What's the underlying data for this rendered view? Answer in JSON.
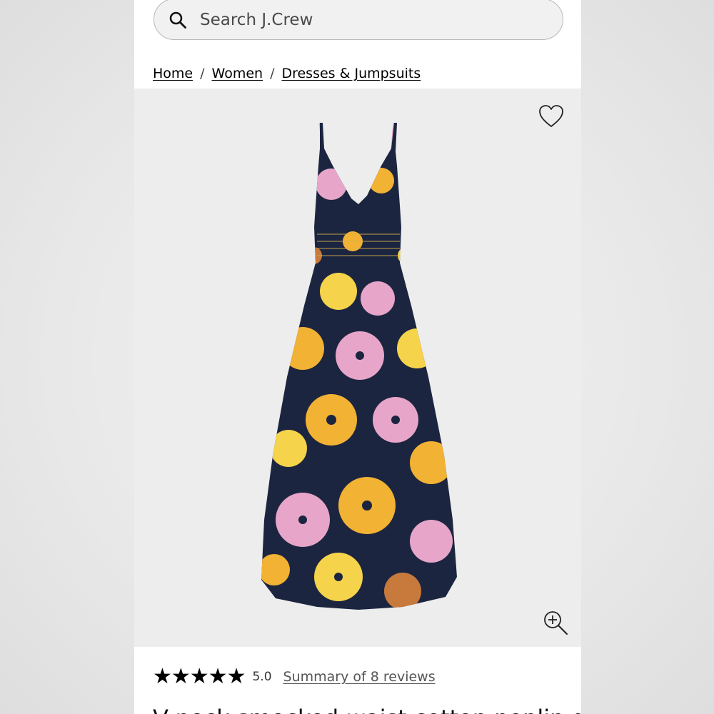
{
  "search": {
    "placeholder": "Search J.Crew",
    "icon": "search-icon"
  },
  "breadcrumb": {
    "items": [
      {
        "label": "Home"
      },
      {
        "label": "Women"
      },
      {
        "label": "Dresses & Jumpsuits"
      }
    ],
    "separator": "/"
  },
  "product_image": {
    "description": "Floral print smocked-waist maxi dress",
    "wishlist_icon": "heart-icon",
    "zoom_icon": "zoom-in-icon",
    "colors": [
      "#1c2540",
      "#f2b233",
      "#e7a6c9",
      "#f5d34a",
      "#c77a3c"
    ]
  },
  "rating": {
    "stars": "★★★★★",
    "score": "5.0",
    "summary_link": "Summary of 8 reviews"
  },
  "product": {
    "title_partial": "V-neck smocked-waist cotton poplin dress"
  },
  "colors": {
    "background": "#e9e9e9",
    "surface": "#ffffff",
    "image_bg": "#ededed",
    "text": "#000000"
  }
}
